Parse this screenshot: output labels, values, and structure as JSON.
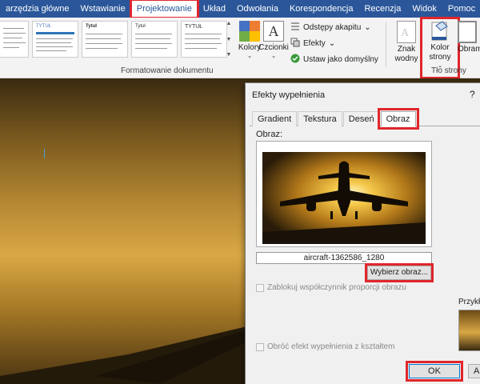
{
  "menu": {
    "items": [
      "arzędzia główne",
      "Wstawianie",
      "Projektowanie",
      "Układ",
      "Odwołania",
      "Korespondencja",
      "Recenzja",
      "Widok",
      "Pomoc"
    ],
    "active_index": 2,
    "bg_color": "#2b579a",
    "tell_me_icon": "lightbulb-icon"
  },
  "ribbon": {
    "style_gallery": [
      {
        "title": ""
      },
      {
        "title": "TYTUŁ"
      },
      {
        "title": "Tytuł"
      },
      {
        "title": "Tytuł"
      },
      {
        "title": "TYTUŁ"
      }
    ],
    "colors_label": "Kolory",
    "fonts_label": "Czcionki",
    "fonts_icon_letter": "A",
    "paragraph_spacing_label": "Odstępy akapitu",
    "effects_label": "Efekty",
    "set_default_label": "Ustaw jako domyślny",
    "format_group_label": "Formatowanie dokumentu",
    "watermark_label_1": "Znak",
    "watermark_label_2": "wodny",
    "page_color_label_1": "Kolor",
    "page_color_label_2": "strony",
    "page_borders_label": "Obram",
    "background_group_label": "Tło strony",
    "highlight_color": "#e0262b"
  },
  "dialog": {
    "title": "Efekty wypełnienia",
    "help": "?",
    "tabs": [
      "Gradient",
      "Tekstura",
      "Deseń",
      "Obraz"
    ],
    "active_tab_index": 3,
    "image_label": "Obraz:",
    "filename": "aircraft-1362586_1280",
    "choose_button": "Wybierz obraz...",
    "lock_aspect_label": "Zablokuj współczynnik proporcji obrazu",
    "rotate_with_shape_label": "Obróć efekt wypełnienia z kształtem",
    "sample_label": "Przykład",
    "ok_button": "OK",
    "cancel_button": "Anuluj"
  }
}
